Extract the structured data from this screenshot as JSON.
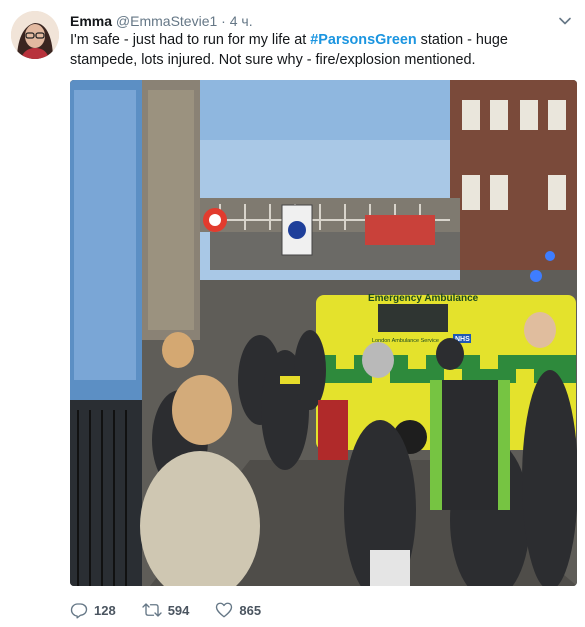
{
  "tweet": {
    "author_name": "Emma",
    "author_handle": "@EmmaStevie1",
    "separator": "·",
    "timestamp": "4 ч.",
    "text_before": "I'm safe - just had to run for my life at ",
    "hashtag": "#ParsonsGreen",
    "text_after": " station - huge stampede, lots injured. Not sure why - fire/explosion mentioned."
  },
  "media": {
    "ambulance_label": "Emergency Ambulance",
    "ambulance_service": "London Ambulance Service",
    "nhs_badge": "NHS"
  },
  "actions": {
    "replies": "128",
    "retweets": "594",
    "likes": "865"
  },
  "icons": {
    "reply": "reply-icon",
    "retweet": "retweet-icon",
    "like": "heart-icon",
    "more": "chevron-down-icon"
  },
  "colors": {
    "link": "#1b95e0",
    "meta": "#657786"
  }
}
